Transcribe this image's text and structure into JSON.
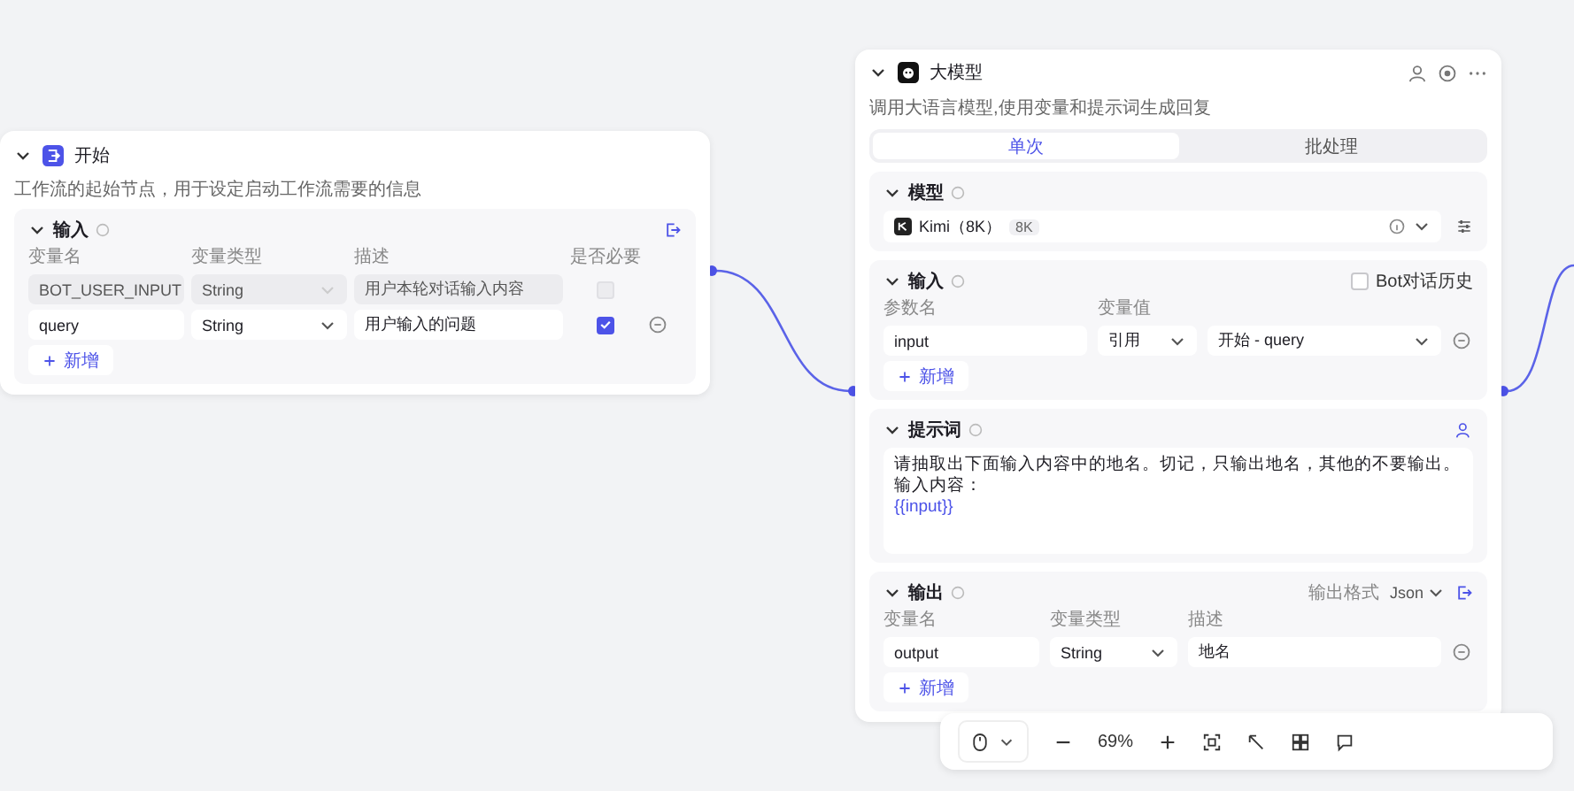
{
  "start_node": {
    "title": "开始",
    "description": "工作流的起始节点，用于设定启动工作流需要的信息",
    "inputs": {
      "title": "输入",
      "columns": [
        "变量名",
        "变量类型",
        "描述",
        "是否必要"
      ],
      "rows": [
        {
          "name": "BOT_USER_INPUT",
          "type": "String",
          "description": "用户本轮对话输入内容",
          "required": false,
          "disabled": true
        },
        {
          "name": "query",
          "type": "String",
          "description": "用户输入的问题",
          "required": true,
          "disabled": false
        }
      ],
      "add_button": "新增"
    }
  },
  "llm_node": {
    "title": "大模型",
    "description": "调用大语言模型,使用变量和提示词生成回复",
    "tabs": [
      {
        "label": "单次",
        "selected": true
      },
      {
        "label": "批处理",
        "selected": false
      }
    ],
    "model": {
      "title": "模型",
      "name": "Kimi（8K）",
      "badge": "8K"
    },
    "inputs": {
      "title": "输入",
      "history_label": "Bot对话历史",
      "history_checked": false,
      "columns": [
        "参数名",
        "变量值"
      ],
      "rows": [
        {
          "name": "input",
          "source": "引用",
          "value": "开始 - query"
        }
      ],
      "add_button": "新增"
    },
    "prompt": {
      "title": "提示词",
      "lines": [
        {
          "text": "请抽取出下面输入内容中的地名。切记，只输出地名，其他的不要输出。",
          "kind": "text"
        },
        {
          "text": "输入内容：",
          "kind": "text"
        },
        {
          "text": "{{input}}",
          "kind": "variable"
        }
      ]
    },
    "output": {
      "title": "输出",
      "format_label": "输出格式",
      "format": "Json",
      "columns": [
        "变量名",
        "变量类型",
        "描述"
      ],
      "rows": [
        {
          "name": "output",
          "type": "String",
          "description": "地名"
        }
      ],
      "add_button": "新增"
    }
  },
  "toolbar": {
    "zoom": "69%"
  }
}
